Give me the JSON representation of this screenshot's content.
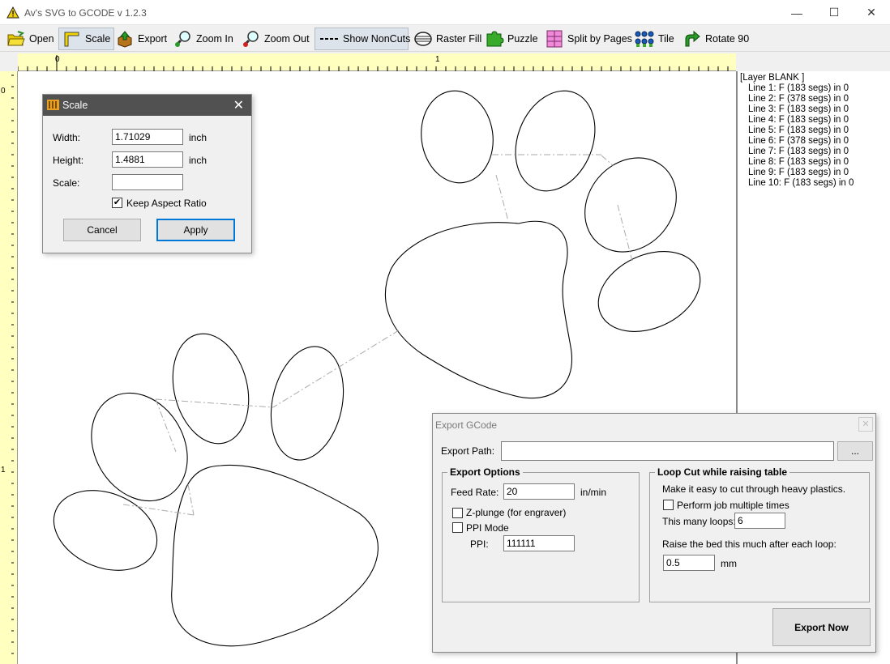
{
  "window": {
    "title": "Av's SVG to GCODE v 1.2.3",
    "minimize_glyph": "—",
    "maximize_glyph": "☐",
    "close_glyph": "✕"
  },
  "toolbar": {
    "open": "Open",
    "scale": "Scale",
    "export": "Export",
    "zoom_in": "Zoom In",
    "zoom_out": "Zoom Out",
    "show_noncuts": "Show NonCuts",
    "raster_fill": "Raster Fill",
    "puzzle": "Puzzle",
    "split_by_pages": "Split by Pages",
    "tile": "Tile",
    "rotate_90": "Rotate 90"
  },
  "rulers": {
    "h_zero": "0",
    "h_one": "1",
    "v_zero": "0",
    "v_one": "1"
  },
  "layers": {
    "header": "[Layer BLANK ]",
    "items": [
      "Line 1: F (183 segs) in 0",
      "Line 2: F (378 segs) in 0",
      "Line 3: F (183 segs) in 0",
      "Line 4: F (183 segs) in 0",
      "Line 5: F (183 segs) in 0",
      "Line 6: F (378 segs) in 0",
      "Line 7: F (183 segs) in 0",
      "Line 8: F (183 segs) in 0",
      "Line 9: F (183 segs) in 0",
      "Line 10: F (183 segs) in 0"
    ]
  },
  "scale_dialog": {
    "title": "Scale",
    "close_glyph": "✕",
    "width_label": "Width:",
    "width_value": "1.71029",
    "width_unit": "inch",
    "height_label": "Height:",
    "height_value": "1.4881",
    "height_unit": "inch",
    "scale_label": "Scale:",
    "scale_value": "",
    "keep_aspect_label": "Keep Aspect Ratio",
    "keep_aspect_checked": true,
    "check_glyph": "✔",
    "cancel": "Cancel",
    "apply": "Apply"
  },
  "export_dialog": {
    "title": "Export GCode",
    "close_glyph": "✕",
    "export_path_label": "Export Path:",
    "export_path_value": "",
    "browse": "...",
    "options_group": "Export Options",
    "feed_rate_label": "Feed Rate:",
    "feed_rate_value": "20",
    "feed_rate_unit": "in/min",
    "zplunge_label": "Z-plunge (for engraver)",
    "zplunge_checked": false,
    "ppi_mode_label": "PPI Mode",
    "ppi_mode_checked": false,
    "ppi_label": "PPI:",
    "ppi_value": "111111",
    "loop_group": "Loop Cut while raising table",
    "loop_desc": "Make it easy to cut through heavy plastics.",
    "perform_multiple_label": "Perform job multiple times",
    "perform_multiple_checked": false,
    "loops_label": "This many loops:",
    "loops_value": "6",
    "raise_label": "Raise the bed this much after each loop:",
    "raise_value": "0.5",
    "raise_unit": "mm",
    "export_now": "Export Now"
  }
}
